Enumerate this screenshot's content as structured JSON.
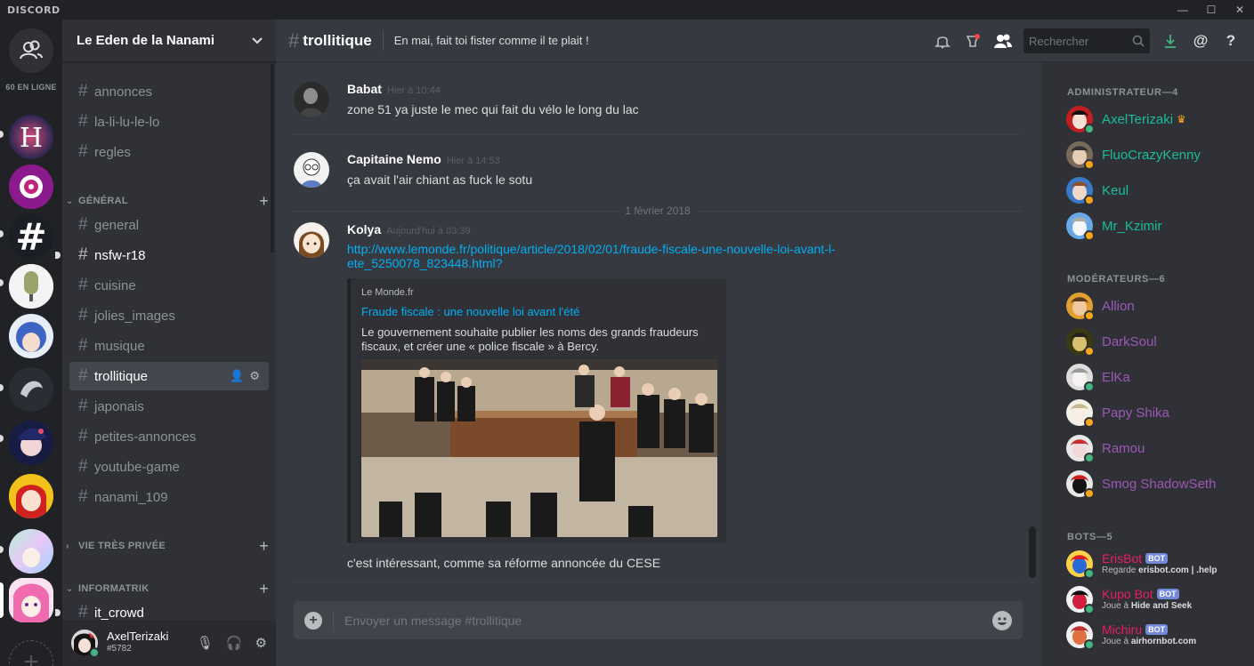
{
  "titlebar": {
    "brand": "DISCORD"
  },
  "guilds": {
    "online_label": "60 EN LIGNE",
    "add_label": "+"
  },
  "server": {
    "name": "Le Eden de la Nanami"
  },
  "channels": [
    {
      "name": "annonces",
      "icon": "#"
    },
    {
      "name": "la-li-lu-le-lo",
      "icon": "#"
    },
    {
      "name": "regles",
      "icon": "#"
    }
  ],
  "categories": {
    "general": "GÉNÉRAL",
    "vie": "VIE TRÈS PRIVÉE",
    "info": "INFORMATRIK"
  },
  "general_channels": [
    {
      "name": "general"
    },
    {
      "name": "nsfw-r18"
    },
    {
      "name": "cuisine"
    },
    {
      "name": "jolies_images"
    },
    {
      "name": "musique"
    },
    {
      "name": "trollitique"
    },
    {
      "name": "japonais"
    },
    {
      "name": "petites-annonces"
    },
    {
      "name": "youtube-game"
    },
    {
      "name": "nanami_109"
    }
  ],
  "info_channels": [
    {
      "name": "it_crowd"
    }
  ],
  "user": {
    "name": "AxelTerizaki",
    "tag": "#5782"
  },
  "chat": {
    "channel": "trollitique",
    "topic": "En mai, fait toi fister comme il te plait !",
    "search_placeholder": "Rechercher",
    "date_separator": "1 février 2018",
    "composer_placeholder": "Envoyer un message #trollitique",
    "messages": [
      {
        "author": "Babat",
        "time": "Hier à 10:44",
        "text": "zone 51 ya juste le mec qui fait du vélo le long du lac"
      },
      {
        "author": "Capitaine Nemo",
        "time": "Hier à 14:53",
        "text": "ça avait l'air chiant as fuck le sotu"
      },
      {
        "author": "Kolya",
        "time": "Aujourd'hui à 03:39",
        "link": "http://www.lemonde.fr/politique/article/2018/02/01/fraude-fiscale-une-nouvelle-loi-avant-l-ete_5250078_823448.html?",
        "link_line1": "http://www.lemonde.fr/politique/article/2018/02/01/fraude-fiscale-une-nouvelle-loi-avant-l-",
        "link_line2": "ete_5250078_823448.html?",
        "text": "c'est intéressant, comme sa réforme annoncée du CESE"
      }
    ],
    "embed": {
      "provider": "Le Monde.fr",
      "title": "Fraude fiscale : une nouvelle loi avant l'été",
      "description": "Le gouvernement souhaite publier les noms des grands fraudeurs fiscaux, et créer une « police fiscale » à Bercy."
    }
  },
  "members": {
    "roles": [
      {
        "title": "ADMINISTRATEUR—4",
        "members": [
          {
            "name": "AxelTerizaki",
            "color": "#1abc9c",
            "status": "#43b581"
          },
          {
            "name": "FluoCrazyKenny",
            "color": "#1abc9c",
            "status": "#faa61a"
          },
          {
            "name": "Keul",
            "color": "#1abc9c",
            "status": "#faa61a"
          },
          {
            "name": "Mr_Kzimir",
            "color": "#1abc9c",
            "status": "#faa61a"
          }
        ]
      },
      {
        "title": "MODÉRATEURS—6",
        "members": [
          {
            "name": "Allion",
            "color": "#9b59b6",
            "status": "#faa61a"
          },
          {
            "name": "DarkSoul",
            "color": "#9b59b6",
            "status": "#faa61a"
          },
          {
            "name": "ElKa",
            "color": "#9b59b6",
            "status": "#43b581"
          },
          {
            "name": "Papy Shika",
            "color": "#9b59b6",
            "status": "#faa61a"
          },
          {
            "name": "Ramou",
            "color": "#9b59b6",
            "status": "#43b581"
          },
          {
            "name": "Smog ShadowSeth",
            "color": "#9b59b6",
            "status": "#faa61a"
          }
        ]
      },
      {
        "title": "BOTS—5",
        "members": [
          {
            "name": "ErisBot",
            "color": "#e91e63",
            "status": "#43b581",
            "bot": "BOT",
            "activity_prefix": "Regarde ",
            "activity": "erisbot.com | .help"
          },
          {
            "name": "Kupo Bot",
            "color": "#e91e63",
            "status": "#43b581",
            "bot": "BOT",
            "activity_prefix": "Joue à ",
            "activity": "Hide and Seek"
          },
          {
            "name": "Michiru",
            "color": "#e91e63",
            "status": "#43b581",
            "bot": "BOT",
            "activity_prefix": "Joue à ",
            "activity": "airhornbot.com"
          }
        ]
      }
    ]
  }
}
